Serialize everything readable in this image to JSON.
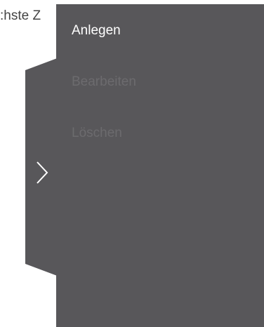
{
  "background": {
    "partial_text": ":hste Z"
  },
  "panel": {
    "toggle_icon": "chevron-right-icon",
    "menu": [
      {
        "label": "Anlegen",
        "enabled": true
      },
      {
        "label": "Bearbeiten",
        "enabled": false
      },
      {
        "label": "Löschen",
        "enabled": false
      }
    ]
  },
  "colors": {
    "panel_bg": "#58575a",
    "enabled_text": "#ffffff",
    "disabled_text": "#6c6b6e"
  }
}
